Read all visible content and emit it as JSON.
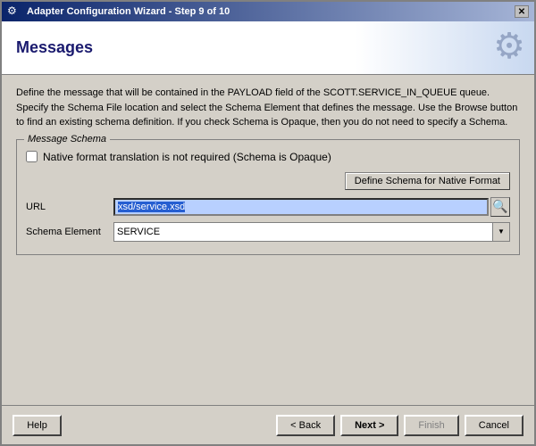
{
  "window": {
    "title": "Adapter Configuration Wizard - Step 9 of 10",
    "close_label": "✕"
  },
  "header": {
    "title": "Messages",
    "gear_icon": "⚙"
  },
  "description": "Define the message that will be contained in the PAYLOAD field of the SCOTT.SERVICE_IN_QUEUE queue.  Specify the Schema File location and select the Schema Element that defines the message. Use the Browse button to find an existing schema definition. If you check Schema is Opaque, then you do not need to specify a Schema.",
  "message_schema": {
    "legend": "Message Schema",
    "opaque_checkbox_label": "Native format translation is not required (Schema is Opaque)",
    "opaque_checked": false,
    "define_schema_btn": "Define Schema for Native Format",
    "url_label": "URL",
    "url_value": "xsd/service.xsd",
    "url_placeholder": "xsd/service.xsd",
    "browse_icon": "🔍",
    "schema_element_label": "Schema Element",
    "schema_element_value": "SERVICE",
    "schema_element_options": [
      "SERVICE"
    ]
  },
  "footer": {
    "help_label": "Help",
    "back_label": "< Back",
    "next_label": "Next >",
    "finish_label": "Finish",
    "cancel_label": "Cancel"
  }
}
